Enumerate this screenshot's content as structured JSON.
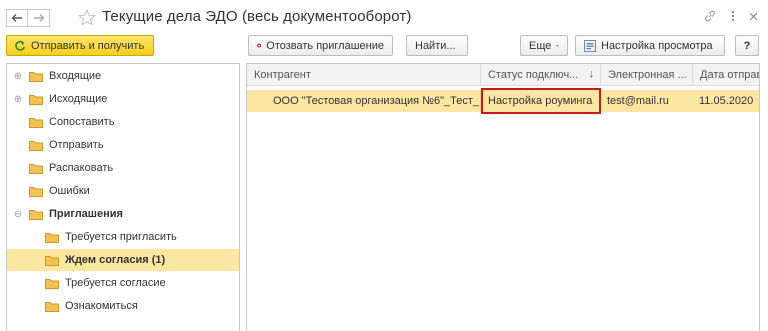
{
  "window": {
    "title": "Текущие дела ЭДО (весь документооборот)",
    "link_icon": "link-icon",
    "more_icon": "more-vertical-icon",
    "close_icon": "close-icon"
  },
  "toolbar_left": {
    "send_receive_label": "Отправить и получить"
  },
  "toolbar_right": {
    "revoke_label": "Отозвать приглашение",
    "find_label": "Найти...",
    "more_label": "Еще",
    "view_settings_label": "Настройка просмотра",
    "help_label": "?"
  },
  "tree": {
    "items": [
      {
        "label": "Входящие",
        "expander": "⊕"
      },
      {
        "label": "Исходящие",
        "expander": "⊕"
      },
      {
        "label": "Сопоставить",
        "expander": ""
      },
      {
        "label": "Отправить",
        "expander": ""
      },
      {
        "label": "Распаковать",
        "expander": ""
      },
      {
        "label": "Ошибки",
        "expander": ""
      },
      {
        "label": "Приглашения",
        "expander": "⊖"
      },
      {
        "label": "Требуется пригласить",
        "expander": ""
      },
      {
        "label": "Ждем согласия (1)",
        "expander": ""
      },
      {
        "label": "Требуется согласие",
        "expander": ""
      },
      {
        "label": "Ознакомиться",
        "expander": ""
      }
    ]
  },
  "grid": {
    "columns": [
      "Контрагент",
      "Статус подключ...",
      "Электронная ...",
      "Дата отправ"
    ],
    "sort_glyph": "↓",
    "rows": [
      {
        "counterparty": "ООО \"Тестовая организация №6\"_Тест_",
        "status": "Настройка роуминга",
        "email": "test@mail.ru",
        "date": "11.05.2020"
      }
    ]
  },
  "colors": {
    "accent_yellow": "#f6cf1f",
    "selection": "#fbe6a2",
    "highlight_border": "#c61b1b",
    "folder": "#e8b84a"
  }
}
